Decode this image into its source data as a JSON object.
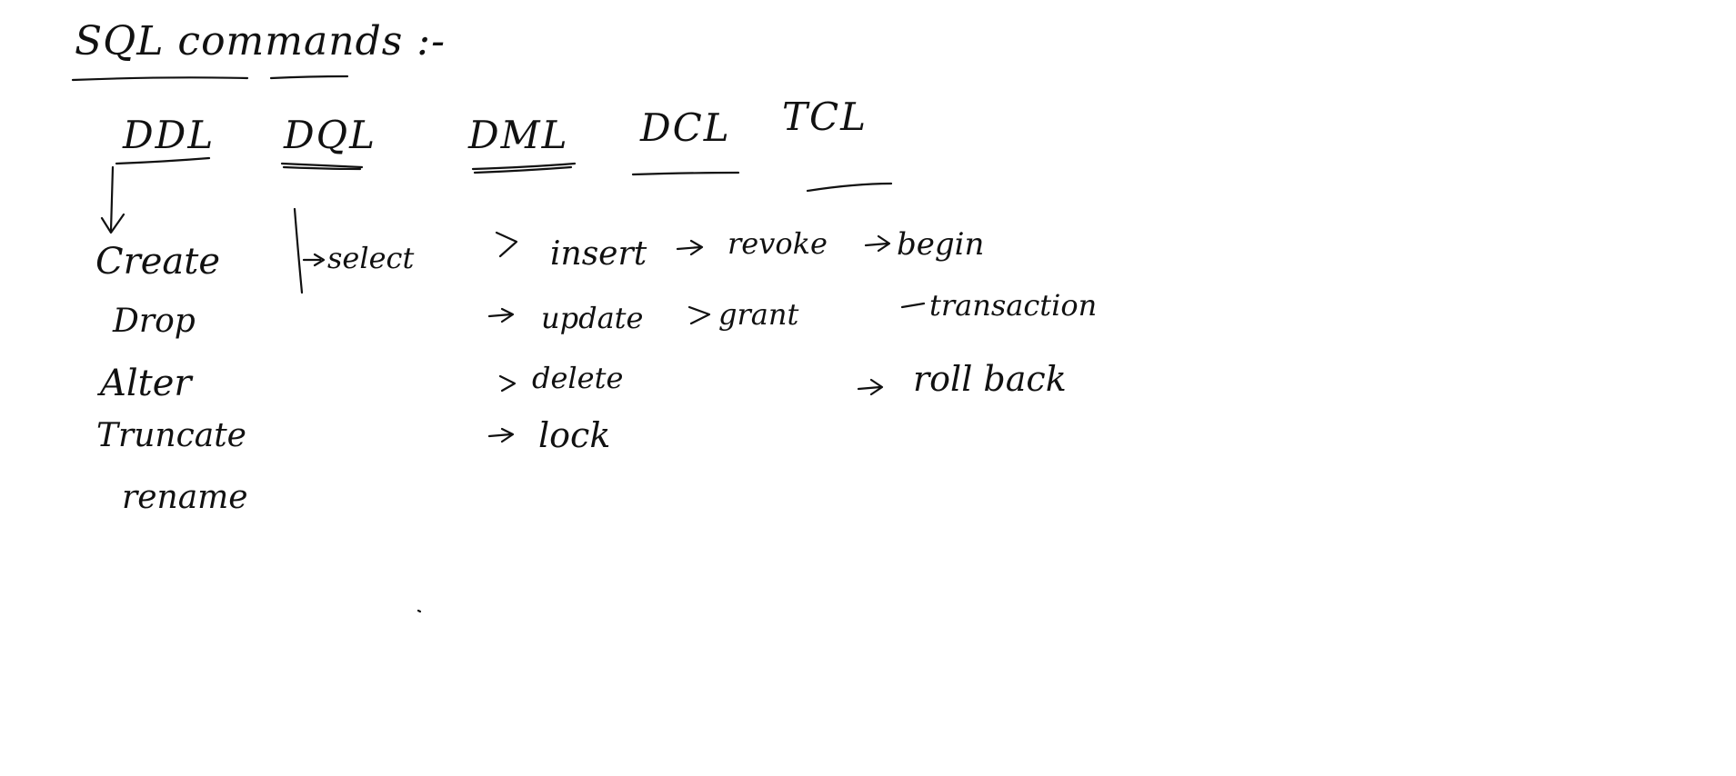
{
  "title": "SQL commands :-",
  "categories": [
    {
      "key": "ddl",
      "label": "DDL",
      "items": [
        "Create",
        "Drop",
        "Alter",
        "Truncate",
        "rename"
      ]
    },
    {
      "key": "dql",
      "label": "DQL",
      "items": [
        "select"
      ]
    },
    {
      "key": "dml",
      "label": "DML",
      "items": [
        "insert",
        "update",
        "delete",
        "lock"
      ]
    },
    {
      "key": "dcl",
      "label": "DCL",
      "items": [
        "revoke",
        "grant"
      ]
    },
    {
      "key": "tcl",
      "label": "TCL",
      "items": [
        "begin",
        "transaction",
        "roll back"
      ]
    }
  ],
  "ink_color": "#111111",
  "background_color": "#ffffff"
}
